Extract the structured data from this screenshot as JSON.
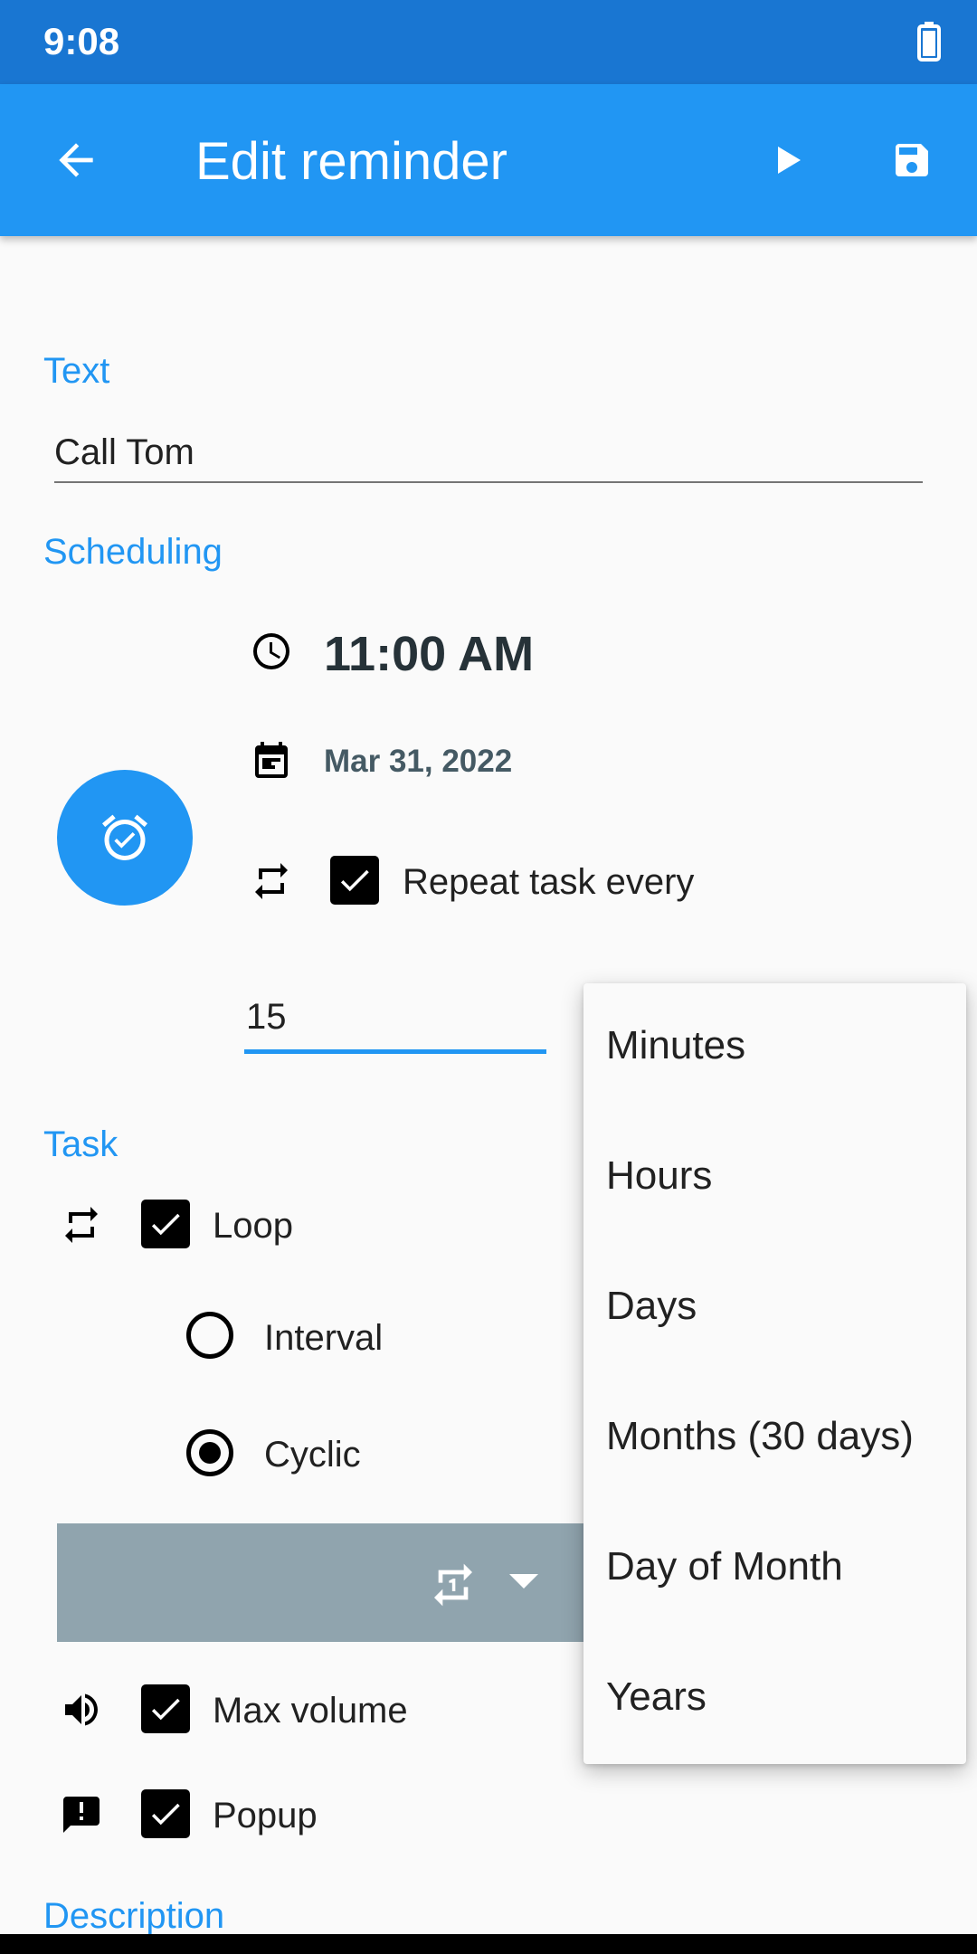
{
  "status_bar": {
    "time": "9:08"
  },
  "app_bar": {
    "title": "Edit reminder"
  },
  "text_section": {
    "label": "Text",
    "value": "Call Tom"
  },
  "scheduling": {
    "label": "Scheduling",
    "time": "11:00 AM",
    "date": "Mar 31, 2022",
    "repeat_label": "Repeat task every",
    "repeat_checked": true,
    "repeat_value": "15"
  },
  "task": {
    "label": "Task",
    "loop_label": "Loop",
    "loop_checked": true,
    "interval_label": "Interval",
    "cyclic_label": "Cyclic",
    "selected_mode": "Cyclic",
    "max_volume_label": "Max volume",
    "popup_label": "Popup"
  },
  "description": {
    "label": "Description"
  },
  "unit_menu": {
    "items": [
      "Minutes",
      "Hours",
      "Days",
      "Months (30 days)",
      "Day of Month",
      "Years"
    ]
  },
  "colors": {
    "primary": "#2196f3",
    "primary_dark": "#1976d2",
    "bar_gray": "#90a4ae"
  }
}
